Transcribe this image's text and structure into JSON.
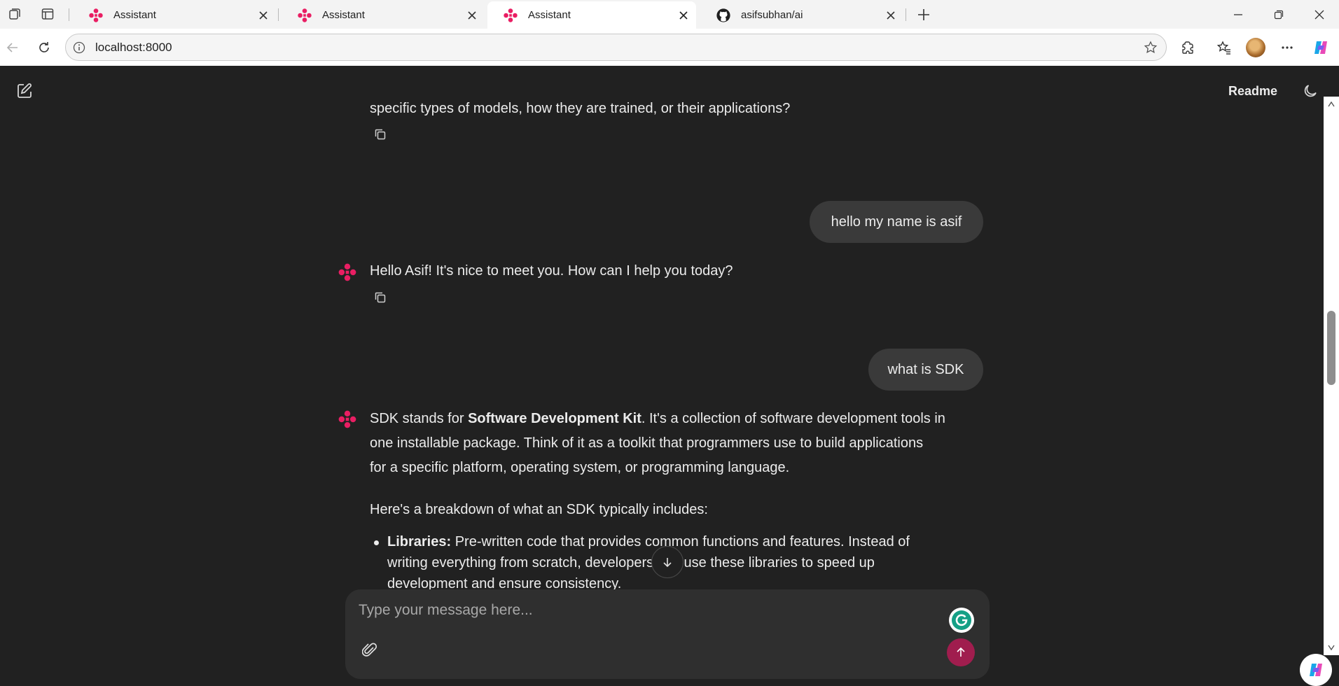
{
  "browser": {
    "tabs": [
      {
        "label": "Assistant",
        "icon": "assistant-logo-icon",
        "active": false
      },
      {
        "label": "Assistant",
        "icon": "assistant-logo-icon",
        "active": false
      },
      {
        "label": "Assistant",
        "icon": "assistant-logo-icon",
        "active": true
      },
      {
        "label": "asifsubhan/ai",
        "icon": "github-icon",
        "active": false
      }
    ],
    "address": "localhost:8000"
  },
  "header": {
    "readme_label": "Readme"
  },
  "messages": [
    {
      "role": "assistant",
      "text": "specific types of models, how they are trained, or their applications?"
    },
    {
      "role": "user",
      "text": "hello my name is asif"
    },
    {
      "role": "assistant",
      "text": "Hello Asif! It's nice to meet you. How can I help you today?"
    },
    {
      "role": "user",
      "text": "what is SDK"
    },
    {
      "role": "assistant",
      "para1": {
        "pre": "SDK stands for ",
        "bold": "Software Development Kit",
        "line1_post": ". It's a collection of software development tools in",
        "line2": "one installable package. Think of it as a toolkit that programmers use to build applications",
        "line3": "for a specific platform, operating system, or programming language."
      },
      "para2": "Here's a breakdown of what an SDK typically includes:",
      "bullets": [
        {
          "term": "Libraries:",
          "line1": " Pre-written code that provides common functions and features. Instead of",
          "line2": "writing everything from scratch, developers can use these libraries to speed up",
          "line3": "development and ensure consistency."
        }
      ]
    }
  ],
  "composer": {
    "placeholder": "Type your message here..."
  },
  "colors": {
    "background": "#212121",
    "bubble": "#3a3a3a",
    "accent": "#e91e63",
    "send_button": "#a01d4e",
    "composer": "#2f2f2f"
  }
}
